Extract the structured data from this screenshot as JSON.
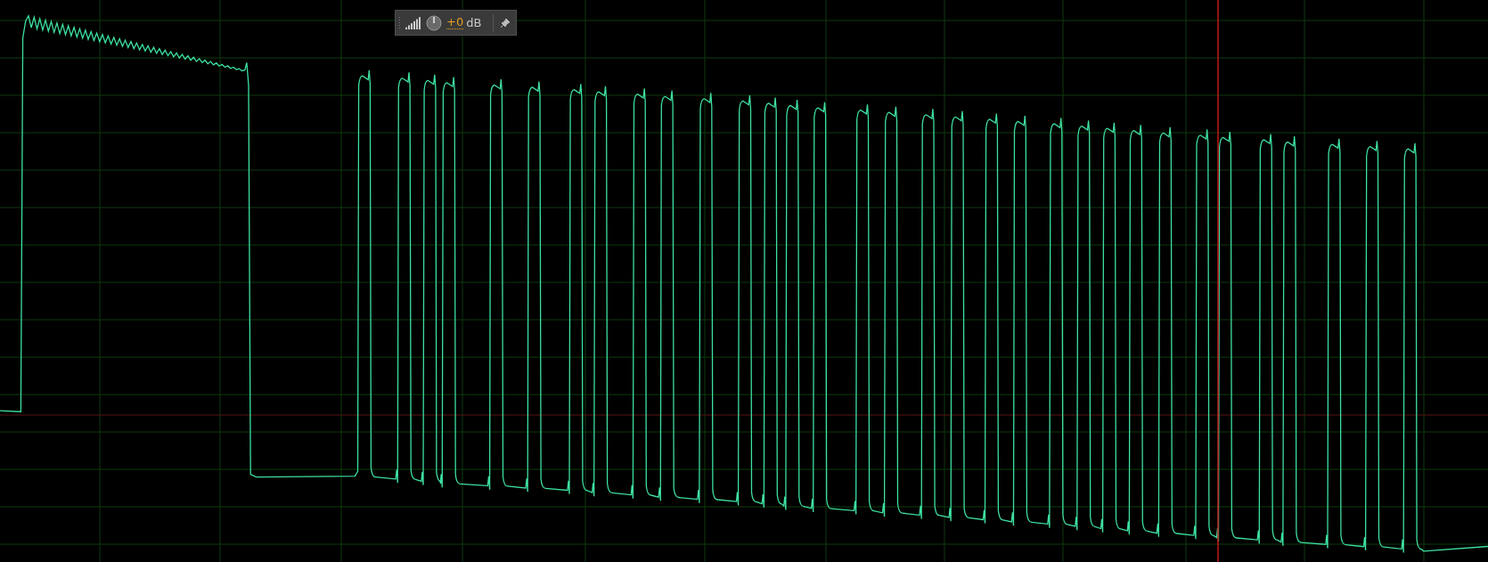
{
  "gain_hud": {
    "gain": "+0",
    "unit": "dB"
  }
}
